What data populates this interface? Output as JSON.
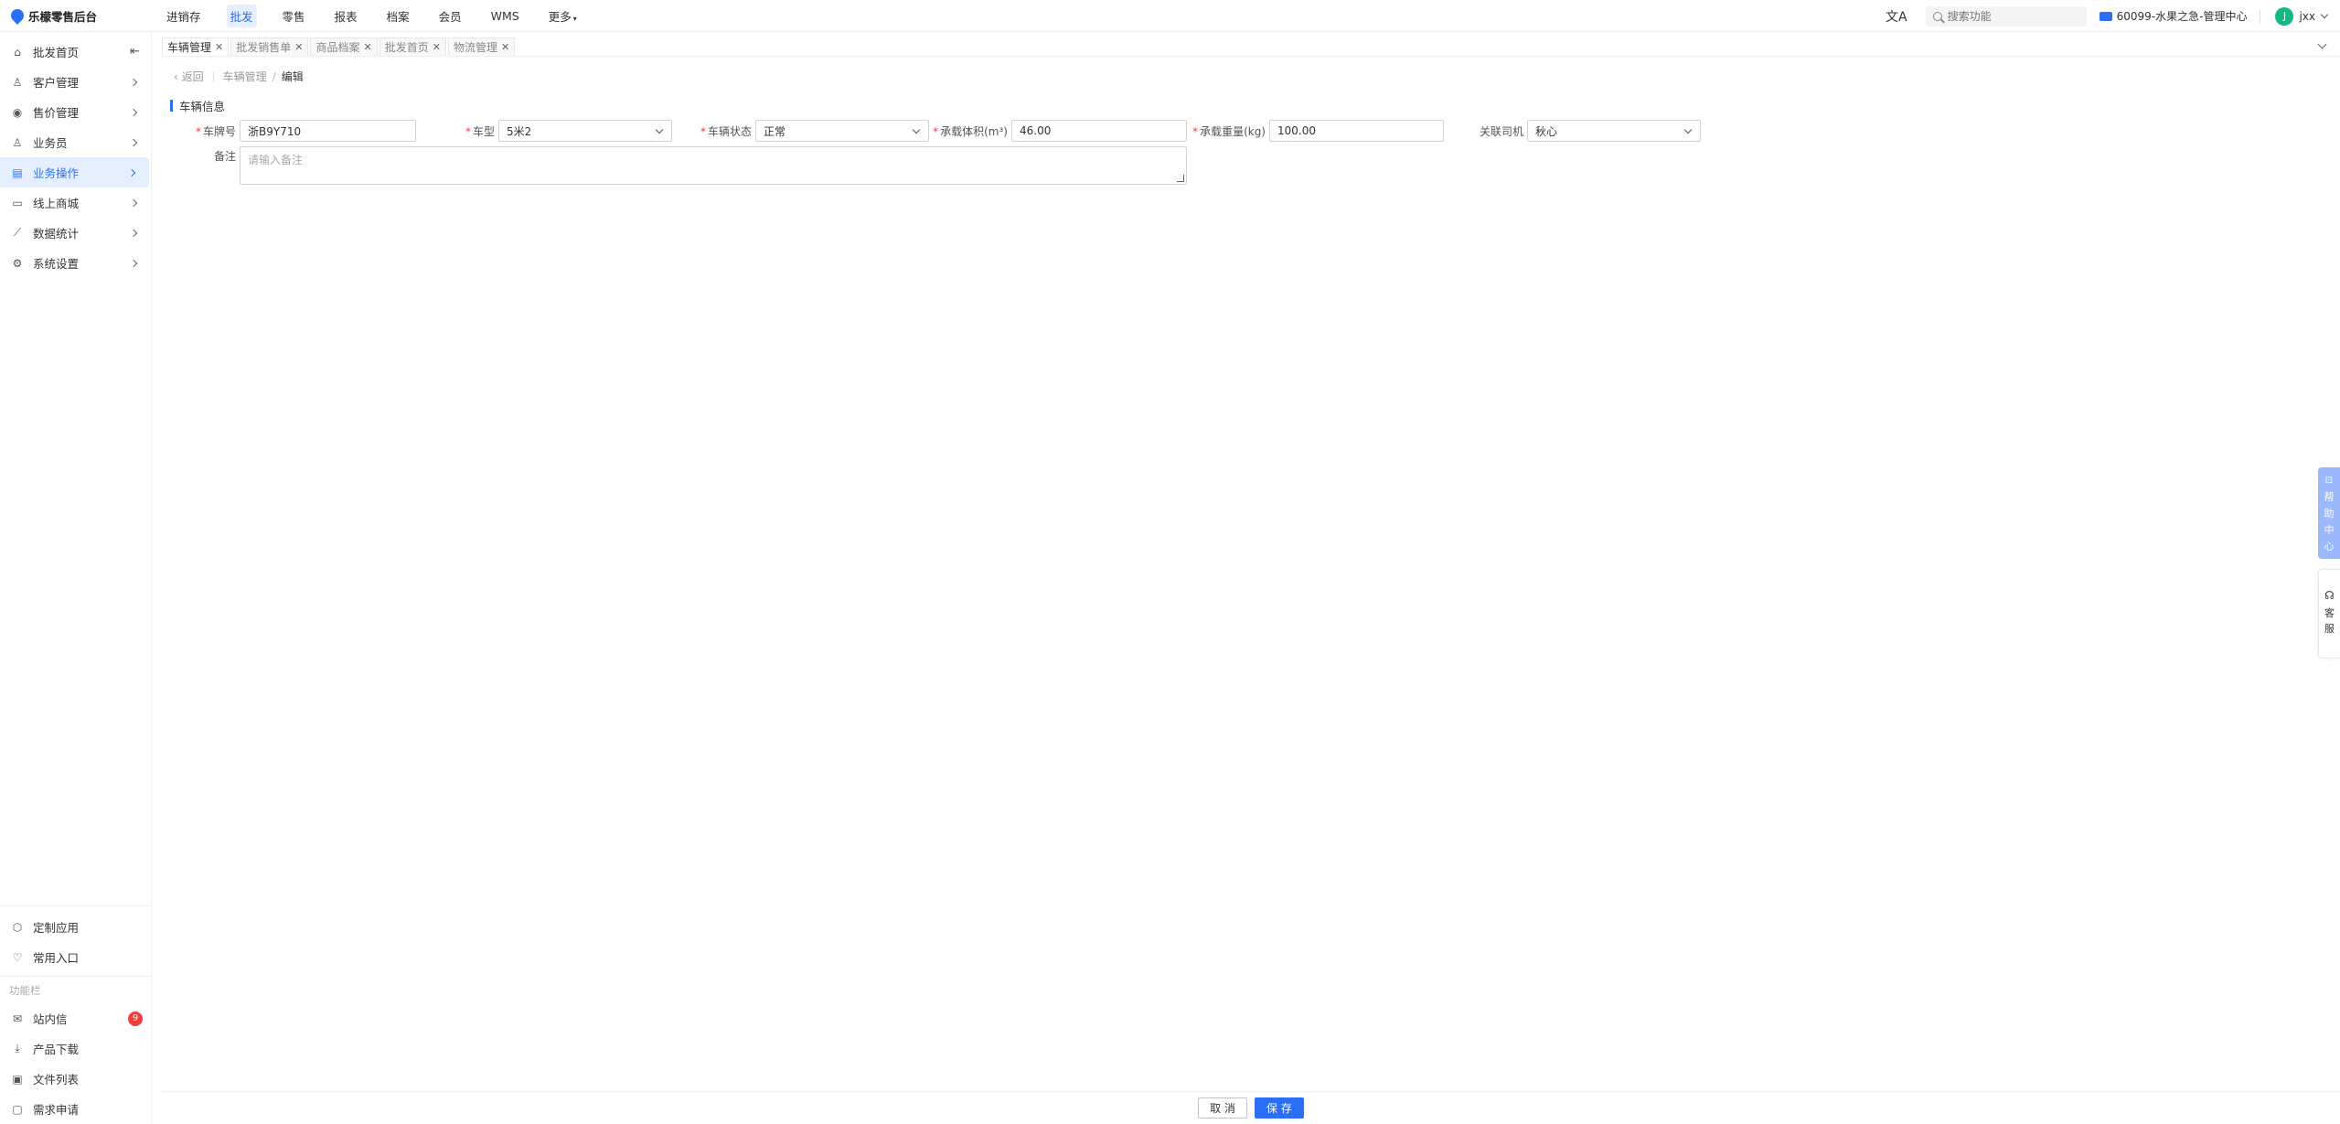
{
  "app": {
    "title": "乐檬零售后台"
  },
  "topnav": [
    {
      "label": "进销存",
      "active": false
    },
    {
      "label": "批发",
      "active": true
    },
    {
      "label": "零售",
      "active": false
    },
    {
      "label": "报表",
      "active": false
    },
    {
      "label": "档案",
      "active": false
    },
    {
      "label": "会员",
      "active": false
    },
    {
      "label": "WMS",
      "active": false
    },
    {
      "label": "更多",
      "active": false
    }
  ],
  "header": {
    "search_placeholder": "搜索功能",
    "store": "60099-水果之急-管理中心",
    "user_initial": "J",
    "user_name": "jxx"
  },
  "sidebar": {
    "items": [
      {
        "label": "批发首页",
        "icon": "home-icon"
      },
      {
        "label": "客户管理",
        "icon": "user-icon"
      },
      {
        "label": "售价管理",
        "icon": "price-icon"
      },
      {
        "label": "业务员",
        "icon": "user-icon"
      },
      {
        "label": "业务操作",
        "icon": "operation-icon"
      },
      {
        "label": "线上商城",
        "icon": "store-icon"
      },
      {
        "label": "数据统计",
        "icon": "chart-icon"
      },
      {
        "label": "系统设置",
        "icon": "settings-icon"
      }
    ],
    "bottom": [
      {
        "label": "定制应用",
        "icon": "cube-icon"
      },
      {
        "label": "常用入口",
        "icon": "heart-icon"
      }
    ],
    "section_label": "功能栏",
    "tools": [
      {
        "label": "站内信",
        "icon": "mail-icon",
        "badge": "9"
      },
      {
        "label": "产品下载",
        "icon": "download-icon"
      },
      {
        "label": "文件列表",
        "icon": "file-icon"
      },
      {
        "label": "需求申请",
        "icon": "request-icon"
      }
    ]
  },
  "tabs": [
    {
      "label": "车辆管理",
      "active": true
    },
    {
      "label": "批发销售单",
      "active": false
    },
    {
      "label": "商品档案",
      "active": false
    },
    {
      "label": "批发首页",
      "active": false
    },
    {
      "label": "物流管理",
      "active": false
    }
  ],
  "breadcrumb": {
    "back": "返回",
    "parent": "车辆管理",
    "current": "编辑"
  },
  "section_title": "车辆信息",
  "form": {
    "plate": {
      "label": "车牌号",
      "value": "浙B9Y710"
    },
    "type": {
      "label": "车型",
      "value": "5米2"
    },
    "status": {
      "label": "车辆状态",
      "value": "正常"
    },
    "volume": {
      "label": "承载体积(m³)",
      "value": "46.00"
    },
    "weight": {
      "label": "承载重量(kg)",
      "value": "100.00"
    },
    "driver": {
      "label": "关联司机",
      "value": "秋心"
    },
    "remark": {
      "label": "备注",
      "placeholder": "请输入备注"
    }
  },
  "footer": {
    "cancel": "取 消",
    "save": "保 存"
  },
  "float": {
    "help": [
      "帮",
      "助",
      "中",
      "心"
    ],
    "service": [
      "客",
      "服"
    ]
  },
  "colors": {
    "accent": "#2a6ff5",
    "required": "#f03e3e"
  }
}
